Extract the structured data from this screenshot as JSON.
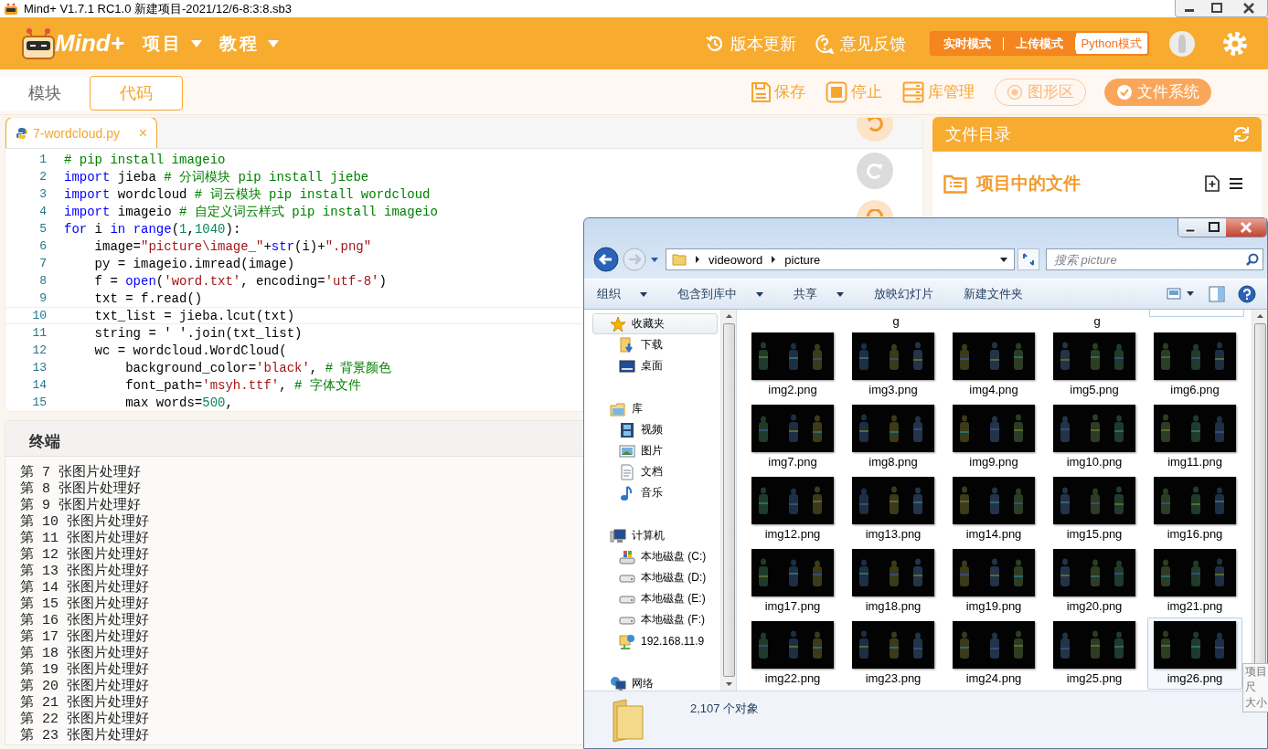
{
  "window": {
    "title": "Mind+ V1.7.1 RC1.0   新建项目-2021/12/6-8:3:8.sb3"
  },
  "header": {
    "logo": "Mind+",
    "menus": [
      {
        "label": "项目"
      },
      {
        "label": "教程"
      }
    ],
    "actions": [
      {
        "label": "版本更新",
        "kind": "update"
      },
      {
        "label": "意见反馈",
        "kind": "feedback"
      }
    ],
    "modes": [
      {
        "label": "实时模式",
        "selected": false
      },
      {
        "label": "上传模式",
        "selected": false
      },
      {
        "label": "Python模式",
        "selected": true
      }
    ]
  },
  "toolbar": {
    "tabs": [
      {
        "label": "模块",
        "selected": false
      },
      {
        "label": "代码",
        "selected": true
      }
    ],
    "tools": [
      {
        "label": "保存",
        "kind": "save"
      },
      {
        "label": "停止",
        "kind": "stop"
      },
      {
        "label": "库管理",
        "kind": "library"
      }
    ],
    "toggles": [
      {
        "label": "图形区",
        "on": false
      },
      {
        "label": "文件系统",
        "on": true
      }
    ]
  },
  "editor": {
    "tab": {
      "label": "7-wordcloud.py",
      "close": "×"
    },
    "float_buttons": [
      {
        "kind": "undo",
        "enabled": true
      },
      {
        "kind": "redo",
        "enabled": false
      },
      {
        "kind": "search",
        "enabled": true
      }
    ],
    "lines": [
      {
        "no": "1",
        "current": false,
        "tokens": [
          {
            "kind": "comment",
            "t": "# pip install imageio"
          }
        ]
      },
      {
        "no": "2",
        "current": false,
        "tokens": [
          {
            "kind": "keyword",
            "t": "import"
          },
          {
            "kind": "plain",
            "t": " jieba "
          },
          {
            "kind": "comment",
            "t": "# 分词模块 pip install jiebe"
          }
        ]
      },
      {
        "no": "3",
        "current": false,
        "tokens": [
          {
            "kind": "keyword",
            "t": "import"
          },
          {
            "kind": "plain",
            "t": " wordcloud "
          },
          {
            "kind": "comment",
            "t": "# 词云模块 pip install wordcloud"
          }
        ]
      },
      {
        "no": "4",
        "current": false,
        "tokens": [
          {
            "kind": "keyword",
            "t": "import"
          },
          {
            "kind": "plain",
            "t": " imageio "
          },
          {
            "kind": "comment",
            "t": "# 自定义词云样式 pip install imageio"
          }
        ]
      },
      {
        "no": "5",
        "current": false,
        "tokens": [
          {
            "kind": "keyword",
            "t": "for"
          },
          {
            "kind": "plain",
            "t": " i "
          },
          {
            "kind": "keyword",
            "t": "in"
          },
          {
            "kind": "keyword",
            "t": " range"
          },
          {
            "kind": "plain",
            "t": "("
          },
          {
            "kind": "number",
            "t": "1"
          },
          {
            "kind": "plain",
            "t": ","
          },
          {
            "kind": "number",
            "t": "1040"
          },
          {
            "kind": "plain",
            "t": "):"
          }
        ]
      },
      {
        "no": "6",
        "current": false,
        "tokens": [
          {
            "kind": "plain",
            "t": "    image="
          },
          {
            "kind": "string",
            "t": "\"picture\\image_\""
          },
          {
            "kind": "plain",
            "t": "+"
          },
          {
            "kind": "keyword",
            "t": "str"
          },
          {
            "kind": "plain",
            "t": "(i)+"
          },
          {
            "kind": "string",
            "t": "\".png\""
          }
        ]
      },
      {
        "no": "7",
        "current": false,
        "tokens": [
          {
            "kind": "plain",
            "t": "    py = imageio.imread(image)"
          }
        ]
      },
      {
        "no": "8",
        "current": false,
        "tokens": [
          {
            "kind": "plain",
            "t": "    f = "
          },
          {
            "kind": "keyword",
            "t": "open"
          },
          {
            "kind": "plain",
            "t": "("
          },
          {
            "kind": "string",
            "t": "'word.txt'"
          },
          {
            "kind": "plain",
            "t": ", encoding="
          },
          {
            "kind": "string",
            "t": "'utf-8'"
          },
          {
            "kind": "plain",
            "t": ")"
          }
        ]
      },
      {
        "no": "9",
        "current": false,
        "tokens": [
          {
            "kind": "plain",
            "t": "    txt = f.read()"
          }
        ]
      },
      {
        "no": "10",
        "current": true,
        "tokens": [
          {
            "kind": "plain",
            "t": "    txt_list = jieba.lcut(txt)"
          }
        ]
      },
      {
        "no": "11",
        "current": false,
        "tokens": [
          {
            "kind": "plain",
            "t": "    string = ' '.join(txt_list)"
          }
        ]
      },
      {
        "no": "12",
        "current": false,
        "tokens": [
          {
            "kind": "plain",
            "t": "    wc = wordcloud.WordCloud("
          }
        ]
      },
      {
        "no": "13",
        "current": false,
        "tokens": [
          {
            "kind": "plain",
            "t": "        background_color="
          },
          {
            "kind": "string",
            "t": "'black'"
          },
          {
            "kind": "plain",
            "t": ", "
          },
          {
            "kind": "comment",
            "t": "# 背景颜色"
          }
        ]
      },
      {
        "no": "14",
        "current": false,
        "tokens": [
          {
            "kind": "plain",
            "t": "        font_path="
          },
          {
            "kind": "string",
            "t": "'msyh.ttf'"
          },
          {
            "kind": "plain",
            "t": ", "
          },
          {
            "kind": "comment",
            "t": "# 字体文件"
          }
        ]
      },
      {
        "no": "15",
        "current": false,
        "tokens": [
          {
            "kind": "plain",
            "t": "        max words="
          },
          {
            "kind": "number",
            "t": "500"
          },
          {
            "kind": "plain",
            "t": ","
          }
        ]
      }
    ]
  },
  "terminal": {
    "title": "终端",
    "lines": [
      "第 7 张图片处理好",
      "第 8 张图片处理好",
      "第 9 张图片处理好",
      "第 10 张图片处理好",
      "第 11 张图片处理好",
      "第 12 张图片处理好",
      "第 13 张图片处理好",
      "第 14 张图片处理好",
      "第 15 张图片处理好",
      "第 16 张图片处理好",
      "第 17 张图片处理好",
      "第 18 张图片处理好",
      "第 19 张图片处理好",
      "第 20 张图片处理好",
      "第 21 张图片处理好",
      "第 22 张图片处理好",
      "第 23 张图片处理好"
    ]
  },
  "files_panel": {
    "title": "文件目录",
    "section": "项目中的文件"
  },
  "explorer": {
    "path": [
      "videoword",
      "picture"
    ],
    "search": {
      "placeholder": "搜索 picture"
    },
    "commands": [
      {
        "label": "组织",
        "menu": true
      },
      {
        "label": "包含到库中",
        "menu": true
      },
      {
        "label": "共享",
        "menu": true
      },
      {
        "label": "放映幻灯片",
        "menu": false
      },
      {
        "label": "新建文件夹",
        "menu": false
      }
    ],
    "nav": [
      {
        "label": "收藏夹",
        "kind": "star",
        "selected": true,
        "children": [
          {
            "label": "下载",
            "kind": "download",
            "selected": false
          },
          {
            "label": "桌面",
            "kind": "desktop",
            "selected": false
          }
        ]
      },
      {
        "label": "库",
        "kind": "library",
        "selected": false,
        "children": [
          {
            "label": "视频",
            "kind": "video",
            "selected": false
          },
          {
            "label": "图片",
            "kind": "pictures",
            "selected": false
          },
          {
            "label": "文档",
            "kind": "document",
            "selected": false
          },
          {
            "label": "音乐",
            "kind": "music",
            "selected": false
          }
        ]
      },
      {
        "label": "计算机",
        "kind": "computer",
        "selected": false,
        "children": [
          {
            "label": "本地磁盘 (C:)",
            "kind": "system-drive",
            "selected": false
          },
          {
            "label": "本地磁盘 (D:)",
            "kind": "drive",
            "selected": false
          },
          {
            "label": "本地磁盘 (E:)",
            "kind": "drive",
            "selected": false
          },
          {
            "label": "本地磁盘 (F:)",
            "kind": "drive",
            "selected": false
          },
          {
            "label": "192.168.11.9",
            "kind": "network-drive",
            "selected": false
          }
        ]
      },
      {
        "label": "网络",
        "kind": "network",
        "selected": false
      }
    ],
    "partial_row": [
      {
        "kind": "cut"
      },
      {
        "kind": "wrap",
        "label": "g"
      },
      {
        "kind": "cut"
      },
      {
        "kind": "wrap",
        "label": "g"
      },
      {
        "kind": "boxed"
      }
    ],
    "files": [
      {
        "name": "img2.png",
        "selected": false
      },
      {
        "name": "img3.png",
        "selected": false
      },
      {
        "name": "img4.png",
        "selected": false
      },
      {
        "name": "img5.png",
        "selected": false
      },
      {
        "name": "img6.png",
        "selected": false
      },
      {
        "name": "img7.png",
        "selected": false
      },
      {
        "name": "img8.png",
        "selected": false
      },
      {
        "name": "img9.png",
        "selected": false
      },
      {
        "name": "img10.png",
        "selected": false
      },
      {
        "name": "img11.png",
        "selected": false
      },
      {
        "name": "img12.png",
        "selected": false
      },
      {
        "name": "img13.png",
        "selected": false
      },
      {
        "name": "img14.png",
        "selected": false
      },
      {
        "name": "img15.png",
        "selected": false
      },
      {
        "name": "img16.png",
        "selected": false
      },
      {
        "name": "img17.png",
        "selected": false
      },
      {
        "name": "img18.png",
        "selected": false
      },
      {
        "name": "img19.png",
        "selected": false
      },
      {
        "name": "img20.png",
        "selected": false
      },
      {
        "name": "img21.png",
        "selected": false
      },
      {
        "name": "img22.png",
        "selected": false
      },
      {
        "name": "img23.png",
        "selected": false
      },
      {
        "name": "img24.png",
        "selected": false
      },
      {
        "name": "img25.png",
        "selected": false
      },
      {
        "name": "img26.png",
        "selected": true
      }
    ],
    "status": "2,107 个对象",
    "tooltip": [
      "项目",
      "尺",
      "大小"
    ]
  }
}
